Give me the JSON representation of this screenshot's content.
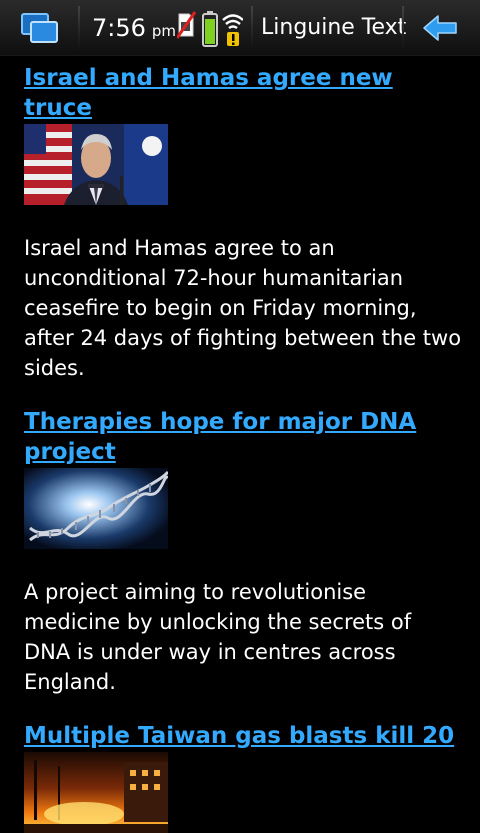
{
  "statusbar": {
    "time": "7:56",
    "ampm": "pm",
    "app_title": "Linguine Text",
    "icons": [
      "task-switcher-icon",
      "sim-card-icon",
      "battery-icon",
      "wifi-icon",
      "back-arrow-icon"
    ],
    "battery_level": 0.85,
    "colors": {
      "accent": "#33aaff",
      "battery": "#7fd021",
      "warning": "#f2c200"
    }
  },
  "articles": [
    {
      "title": "Israel and Hamas agree new truce",
      "body": "Israel and Hamas agree to an unconditional 72-hour humanitarian ceasefire to begin on Friday morning, after 24 days of fighting between the two sides."
    },
    {
      "title": "Therapies hope for major DNA project",
      "body": "A project aiming to revolutionise medicine by unlocking the secrets of DNA is under way in centres across England."
    },
    {
      "title": "Multiple Taiwan gas blasts kill 20",
      "body": ""
    }
  ]
}
